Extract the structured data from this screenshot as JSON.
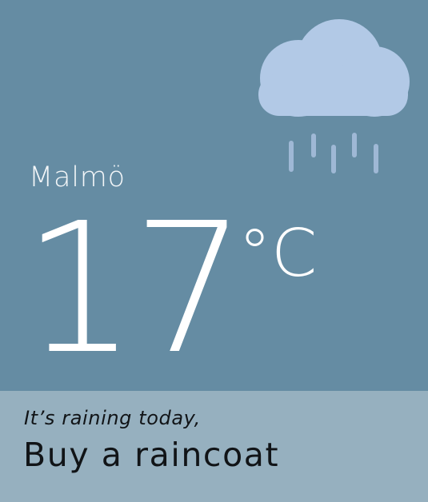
{
  "location": {
    "city": "Malmö"
  },
  "weather": {
    "condition_icon": "rain-cloud-icon",
    "temperature": "17",
    "unit": "°C"
  },
  "message": {
    "subtitle": "It’s raining today,",
    "headline": "Buy a raincoat"
  },
  "colors": {
    "top_background": "#658ca3",
    "bottom_background": "#96b0bf",
    "cloud": "#b2c9e6",
    "raindrops": "#9fb8d5",
    "text_light": "#ffffff",
    "text_dark": "#111417"
  }
}
